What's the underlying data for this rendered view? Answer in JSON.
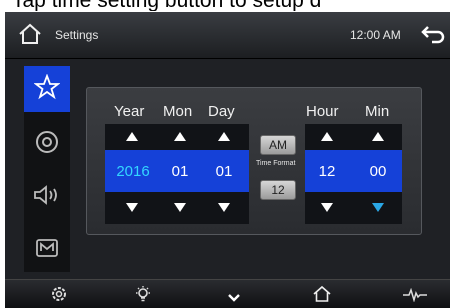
{
  "caption": "Tap time setting button to setup d",
  "header": {
    "title": "Settings",
    "time": "12:00 AM"
  },
  "sidebar": {
    "items": [
      {
        "icon": "star-icon",
        "active": true
      },
      {
        "icon": "disc-icon",
        "active": false
      },
      {
        "icon": "speaker-icon",
        "active": false
      },
      {
        "icon": "media-icon",
        "active": false
      }
    ]
  },
  "datetime": {
    "year_label": "Year",
    "month_label": "Mon",
    "day_label": "Day",
    "hour_label": "Hour",
    "min_label": "Min",
    "year": "2016",
    "month": "01",
    "day": "01",
    "hour": "12",
    "minute": "00",
    "ampm": "AM",
    "time_format_label": "Time Format",
    "time_format": "12"
  },
  "bottombar": {
    "items": [
      "gear-icon",
      "brightness-icon",
      "chevron-down-icon",
      "home-icon",
      "equalizer-icon"
    ]
  },
  "colors": {
    "accent": "#1541d8",
    "year_value": "#33d6ff"
  }
}
